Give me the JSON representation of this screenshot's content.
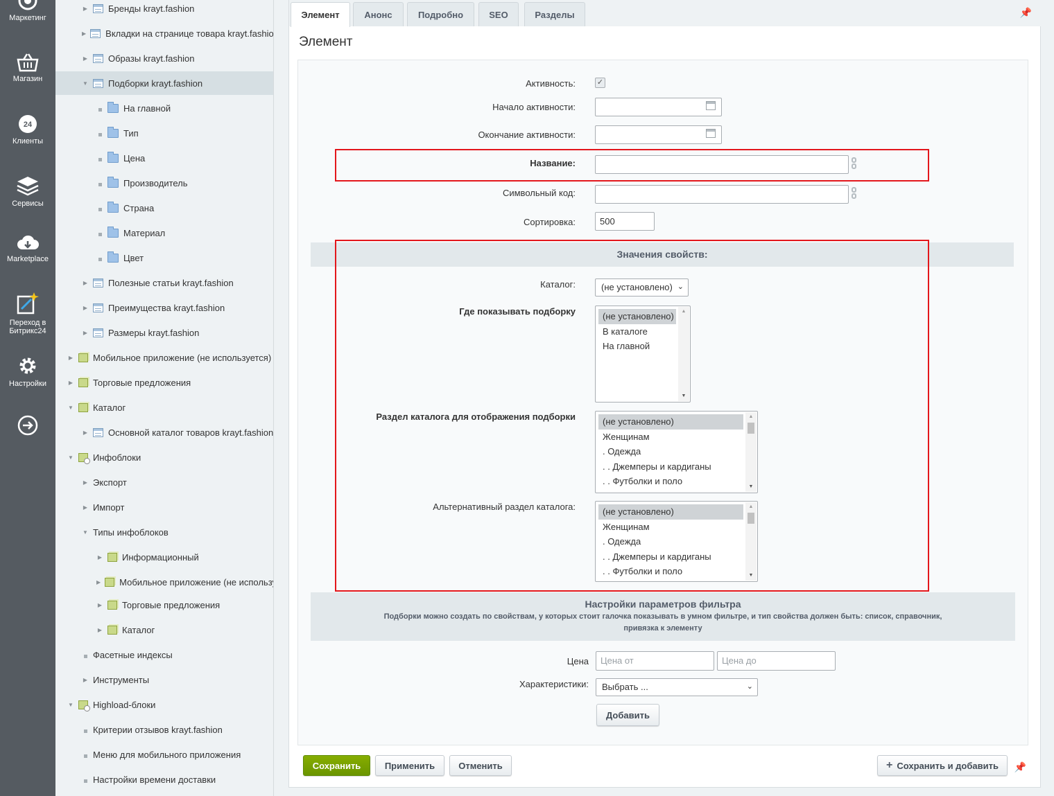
{
  "rail": {
    "items": [
      {
        "label": "Маркетинг",
        "icon": "target-icon"
      },
      {
        "label": "Магазин",
        "icon": "basket-icon"
      },
      {
        "label": "Клиенты",
        "icon": "clients-24-icon"
      },
      {
        "label": "Сервисы",
        "icon": "layers-icon"
      },
      {
        "label": "Marketplace",
        "icon": "cloud-download-icon"
      },
      {
        "label": "Переход в Битрикс24",
        "label_line1": "Переход в",
        "label_line2": "Битрикс24",
        "icon": "magic-edit-icon"
      },
      {
        "label": "Настройки",
        "icon": "gear-icon"
      },
      {
        "label": "",
        "icon": "arrow-right-circle-icon"
      }
    ]
  },
  "tree": {
    "items": [
      {
        "label": "Бренды krayt.fashion"
      },
      {
        "label": "Вкладки на странице товара krayt.fashion"
      },
      {
        "label": "Образы krayt.fashion"
      },
      {
        "label": "Подборки krayt.fashion"
      },
      {
        "label": "На главной"
      },
      {
        "label": "Тип"
      },
      {
        "label": "Цена"
      },
      {
        "label": "Производитель"
      },
      {
        "label": "Страна"
      },
      {
        "label": "Материал"
      },
      {
        "label": "Цвет"
      },
      {
        "label": "Полезные статьи krayt.fashion"
      },
      {
        "label": "Преимущества krayt.fashion"
      },
      {
        "label": "Размеры krayt.fashion"
      },
      {
        "label": "Мобильное приложение (не используется)"
      },
      {
        "label": "Торговые предложения"
      },
      {
        "label": "Каталог"
      },
      {
        "label": "Основной каталог товаров krayt.fashion"
      },
      {
        "label": "Инфоблоки"
      },
      {
        "label": "Экспорт"
      },
      {
        "label": "Импорт"
      },
      {
        "label": "Типы инфоблоков"
      },
      {
        "label": "Информационный"
      },
      {
        "label": "Мобильное приложение (не используется)"
      },
      {
        "label": "Торговые предложения"
      },
      {
        "label": "Каталог"
      },
      {
        "label": "Фасетные индексы"
      },
      {
        "label": "Инструменты"
      },
      {
        "label": "Highload-блоки"
      },
      {
        "label": "Критерии отзывов krayt.fashion"
      },
      {
        "label": "Меню для мобильного приложения"
      },
      {
        "label": "Настройки времени доставки"
      }
    ]
  },
  "tabs": [
    {
      "label": "Элемент",
      "active": true
    },
    {
      "label": "Анонс"
    },
    {
      "label": "Подробно"
    },
    {
      "label": "SEO"
    },
    {
      "label": "Разделы"
    }
  ],
  "page_title": "Элемент",
  "form": {
    "active_label": "Активность:",
    "active_checked": true,
    "start_label": "Начало активности:",
    "start_value": "",
    "end_label": "Окончание активности:",
    "end_value": "",
    "name_label": "Название:",
    "name_value": "",
    "code_label": "Символьный код:",
    "code_value": "",
    "sort_label": "Сортировка:",
    "sort_value": "500"
  },
  "properties": {
    "header": "Значения свойств:",
    "catalog_label": "Каталог:",
    "catalog_value": "(не установлено)",
    "where_label": "Где показывать подборку",
    "where_options": [
      "(не установлено)",
      "В каталоге",
      "На главной"
    ],
    "section_label": "Раздел каталога для отображения подборки",
    "section_options": [
      "(не установлено)",
      "Женщинам",
      ". Одежда",
      ". . Джемперы и кардиганы",
      ". . Футболки и поло"
    ],
    "alt_label": "Альтернативный раздел каталога:",
    "alt_options": [
      "(не установлено)",
      "Женщинам",
      ". Одежда",
      ". . Джемперы и кардиганы",
      ". . Футболки и поло"
    ]
  },
  "filter": {
    "title": "Настройки параметров фильтра",
    "desc_line1": "Подборки можно создать по свойствам, у которых стоит галочка показывать в умном фильтре, и тип свойства должен быть: список, справочник,",
    "desc_line2": "привязка к элементу",
    "price_label": "Цена",
    "price_from_placeholder": "Цена от",
    "price_to_placeholder": "Цена до",
    "chars_label": "Характеристики:",
    "chars_value": "Выбрать ...",
    "add_button": "Добавить"
  },
  "footer": {
    "save": "Сохранить",
    "apply": "Применить",
    "cancel": "Отменить",
    "save_add": "Сохранить и добавить"
  },
  "colors": {
    "rail_bg": "#555b61",
    "save_green": "#79a100",
    "highlight_red": "#e3161b"
  }
}
